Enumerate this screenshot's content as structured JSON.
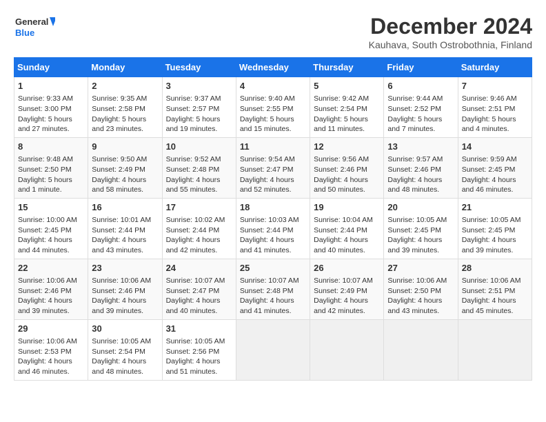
{
  "logo": {
    "line1": "General",
    "line2": "Blue"
  },
  "title": "December 2024",
  "subtitle": "Kauhava, South Ostrobothnia, Finland",
  "weekdays": [
    "Sunday",
    "Monday",
    "Tuesday",
    "Wednesday",
    "Thursday",
    "Friday",
    "Saturday"
  ],
  "days": [
    {
      "num": "",
      "info": ""
    },
    {
      "num": "2",
      "info": "Sunrise: 9:35 AM\nSunset: 2:58 PM\nDaylight: 5 hours\nand 23 minutes."
    },
    {
      "num": "3",
      "info": "Sunrise: 9:37 AM\nSunset: 2:57 PM\nDaylight: 5 hours\nand 19 minutes."
    },
    {
      "num": "4",
      "info": "Sunrise: 9:40 AM\nSunset: 2:55 PM\nDaylight: 5 hours\nand 15 minutes."
    },
    {
      "num": "5",
      "info": "Sunrise: 9:42 AM\nSunset: 2:54 PM\nDaylight: 5 hours\nand 11 minutes."
    },
    {
      "num": "6",
      "info": "Sunrise: 9:44 AM\nSunset: 2:52 PM\nDaylight: 5 hours\nand 7 minutes."
    },
    {
      "num": "7",
      "info": "Sunrise: 9:46 AM\nSunset: 2:51 PM\nDaylight: 5 hours\nand 4 minutes."
    },
    {
      "num": "8",
      "info": "Sunrise: 9:48 AM\nSunset: 2:50 PM\nDaylight: 5 hours\nand 1 minute."
    },
    {
      "num": "9",
      "info": "Sunrise: 9:50 AM\nSunset: 2:49 PM\nDaylight: 4 hours\nand 58 minutes."
    },
    {
      "num": "10",
      "info": "Sunrise: 9:52 AM\nSunset: 2:48 PM\nDaylight: 4 hours\nand 55 minutes."
    },
    {
      "num": "11",
      "info": "Sunrise: 9:54 AM\nSunset: 2:47 PM\nDaylight: 4 hours\nand 52 minutes."
    },
    {
      "num": "12",
      "info": "Sunrise: 9:56 AM\nSunset: 2:46 PM\nDaylight: 4 hours\nand 50 minutes."
    },
    {
      "num": "13",
      "info": "Sunrise: 9:57 AM\nSunset: 2:46 PM\nDaylight: 4 hours\nand 48 minutes."
    },
    {
      "num": "14",
      "info": "Sunrise: 9:59 AM\nSunset: 2:45 PM\nDaylight: 4 hours\nand 46 minutes."
    },
    {
      "num": "15",
      "info": "Sunrise: 10:00 AM\nSunset: 2:45 PM\nDaylight: 4 hours\nand 44 minutes."
    },
    {
      "num": "16",
      "info": "Sunrise: 10:01 AM\nSunset: 2:44 PM\nDaylight: 4 hours\nand 43 minutes."
    },
    {
      "num": "17",
      "info": "Sunrise: 10:02 AM\nSunset: 2:44 PM\nDaylight: 4 hours\nand 42 minutes."
    },
    {
      "num": "18",
      "info": "Sunrise: 10:03 AM\nSunset: 2:44 PM\nDaylight: 4 hours\nand 41 minutes."
    },
    {
      "num": "19",
      "info": "Sunrise: 10:04 AM\nSunset: 2:44 PM\nDaylight: 4 hours\nand 40 minutes."
    },
    {
      "num": "20",
      "info": "Sunrise: 10:05 AM\nSunset: 2:45 PM\nDaylight: 4 hours\nand 39 minutes."
    },
    {
      "num": "21",
      "info": "Sunrise: 10:05 AM\nSunset: 2:45 PM\nDaylight: 4 hours\nand 39 minutes."
    },
    {
      "num": "22",
      "info": "Sunrise: 10:06 AM\nSunset: 2:46 PM\nDaylight: 4 hours\nand 39 minutes."
    },
    {
      "num": "23",
      "info": "Sunrise: 10:06 AM\nSunset: 2:46 PM\nDaylight: 4 hours\nand 39 minutes."
    },
    {
      "num": "24",
      "info": "Sunrise: 10:07 AM\nSunset: 2:47 PM\nDaylight: 4 hours\nand 40 minutes."
    },
    {
      "num": "25",
      "info": "Sunrise: 10:07 AM\nSunset: 2:48 PM\nDaylight: 4 hours\nand 41 minutes."
    },
    {
      "num": "26",
      "info": "Sunrise: 10:07 AM\nSunset: 2:49 PM\nDaylight: 4 hours\nand 42 minutes."
    },
    {
      "num": "27",
      "info": "Sunrise: 10:06 AM\nSunset: 2:50 PM\nDaylight: 4 hours\nand 43 minutes."
    },
    {
      "num": "28",
      "info": "Sunrise: 10:06 AM\nSunset: 2:51 PM\nDaylight: 4 hours\nand 45 minutes."
    },
    {
      "num": "29",
      "info": "Sunrise: 10:06 AM\nSunset: 2:53 PM\nDaylight: 4 hours\nand 46 minutes."
    },
    {
      "num": "30",
      "info": "Sunrise: 10:05 AM\nSunset: 2:54 PM\nDaylight: 4 hours\nand 48 minutes."
    },
    {
      "num": "31",
      "info": "Sunrise: 10:05 AM\nSunset: 2:56 PM\nDaylight: 4 hours\nand 51 minutes."
    },
    {
      "num": "1",
      "info": "Sunrise: 9:33 AM\nSunset: 3:00 PM\nDaylight: 5 hours\nand 27 minutes."
    }
  ]
}
